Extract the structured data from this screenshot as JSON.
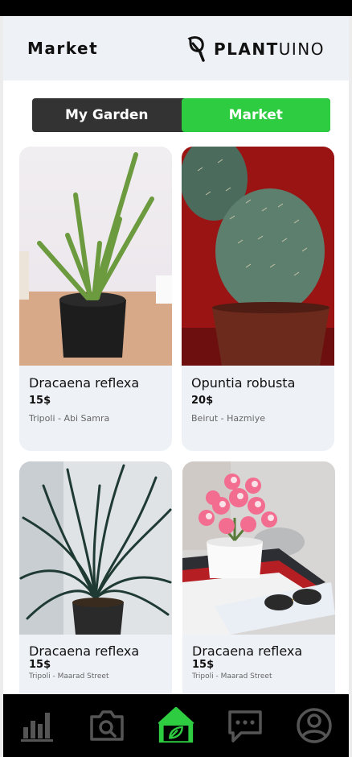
{
  "header": {
    "title": "Market",
    "brand_bold": "PLANT",
    "brand_light": "UINO"
  },
  "toggle": {
    "options": [
      {
        "label": "My Garden",
        "active": false
      },
      {
        "label": "Market",
        "active": true
      }
    ]
  },
  "products": [
    {
      "name": "Dracaena reflexa",
      "price": "15$",
      "location": "Tripoli - Abi Samra",
      "image": "aloe-plant"
    },
    {
      "name": "Opuntia robusta",
      "price": "20$",
      "location": "Beirut - Hazmiye",
      "image": "cactus-plant"
    },
    {
      "name": "Dracaena reflexa",
      "price": "15$",
      "location": "Tripoli - Maarad Street",
      "image": "dracaena-plant"
    },
    {
      "name": "Dracaena reflexa",
      "price": "15$",
      "location": "Tripoli - Maarad Street",
      "image": "pink-flower-plant"
    }
  ],
  "nav": {
    "items": [
      {
        "icon": "bar-chart-icon",
        "active": false
      },
      {
        "icon": "camera-search-icon",
        "active": false
      },
      {
        "icon": "home-leaf-icon",
        "active": true
      },
      {
        "icon": "chat-icon",
        "active": false
      },
      {
        "icon": "user-profile-icon",
        "active": false
      }
    ]
  },
  "colors": {
    "accent": "#2ecc40",
    "header_bg": "#eef1f6",
    "card_bg": "#eef1f6",
    "nav_bg": "#000000",
    "toggle_inactive": "#333333",
    "nav_icon": "#555555"
  }
}
